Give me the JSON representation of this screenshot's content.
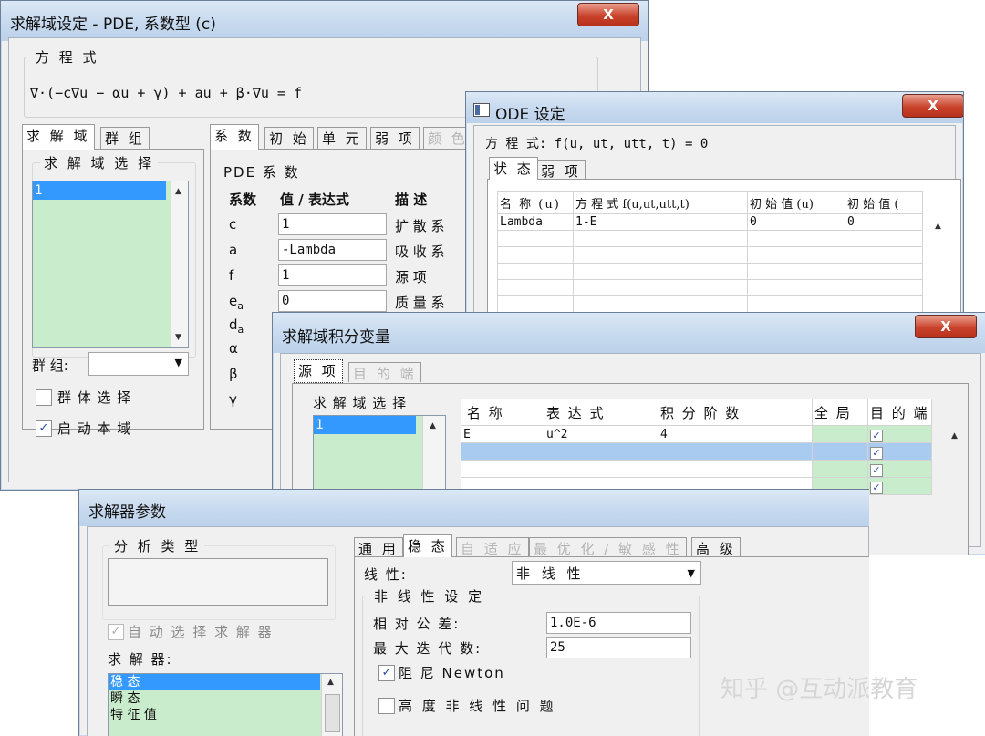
{
  "w1": {
    "title": "求解域设定 - PDE, 系数型 (c)",
    "close": "X",
    "eq_group": "方 程 式",
    "equation": "∇·(−c∇u − αu + γ) + au + β·∇u = f",
    "left_tabs": [
      "求 解 域",
      "群 组"
    ],
    "domain_select": "求 解 域 选 择",
    "domain_items": [
      "1"
    ],
    "group_label": "群 组:",
    "group_select_check": "群 体 选 择",
    "activate_check": "启 动 本 域",
    "right_tabs": [
      "系 数",
      "初 始",
      "单 元",
      "弱 项",
      "颜 色"
    ],
    "pde_group": "PDE 系 数",
    "headers": [
      "系数",
      "值 / 表达式",
      "描 述"
    ],
    "coef_rows": [
      {
        "sym": "c",
        "value": "1",
        "desc": "扩 散 系"
      },
      {
        "sym": "a",
        "value": "-Lambda",
        "desc": "吸 收 系"
      },
      {
        "sym": "f",
        "value": "1",
        "desc": "源 项"
      },
      {
        "sym": "e",
        "sub": "a",
        "value": "0",
        "desc": "质 量 系"
      },
      {
        "sym": "d",
        "sub": "a",
        "value": "",
        "desc": ""
      },
      {
        "sym": "α",
        "value": "",
        "desc": ""
      },
      {
        "sym": "β",
        "value": "",
        "desc": ""
      },
      {
        "sym": "γ",
        "value": "",
        "desc": ""
      }
    ]
  },
  "w2": {
    "title": "ODE 设定",
    "close": "X",
    "equation": "方 程 式: f(u, ut, utt, t) = 0",
    "tabs": [
      "状 态",
      "弱 项"
    ],
    "columns": [
      "名 称 (u)",
      "方 程 式 f(u,ut,utt,t)",
      "初 始 值 (u)",
      "初 始 值 ("
    ],
    "rows": [
      [
        "Lambda",
        "1-E",
        "0",
        "0"
      ]
    ]
  },
  "w3": {
    "title": "求解域积分变量",
    "close": "X",
    "tabs": [
      "源 项",
      "目 的 端"
    ],
    "domain_select": "求 解 域 选 择",
    "domain_items": [
      "1"
    ],
    "columns": [
      "名 称",
      "表 达 式",
      "积 分 阶 数",
      "全 局",
      "目 的 端"
    ],
    "rows": [
      [
        "E",
        "u^2",
        "4"
      ]
    ],
    "check_mark": "✓"
  },
  "w4": {
    "title": "求解器参数",
    "analysis_group": "分 析 类 型",
    "auto_select": "自 动 选 择 求 解 器",
    "solver_label": "求 解 器:",
    "solvers": [
      "稳 态",
      "瞬 态",
      "特 征 值"
    ],
    "tabs": [
      "通 用",
      "稳 态",
      "自 适 应",
      "最 优 化 / 敏 感 性",
      "高 级"
    ],
    "linearity_label": "线 性:",
    "linearity_value": "非 线 性",
    "nonlinear_group": "非 线 性 设 定",
    "rel_tol_label": "相 对 公 差:",
    "rel_tol_value": "1.0E-6",
    "max_iter_label": "最 大 迭 代 数:",
    "max_iter_value": "25",
    "damped_check": "阻 尼 Newton",
    "highly_nonlinear_check": "高 度 非 线 性 问 题"
  },
  "watermark": "知乎 @互动派教育"
}
